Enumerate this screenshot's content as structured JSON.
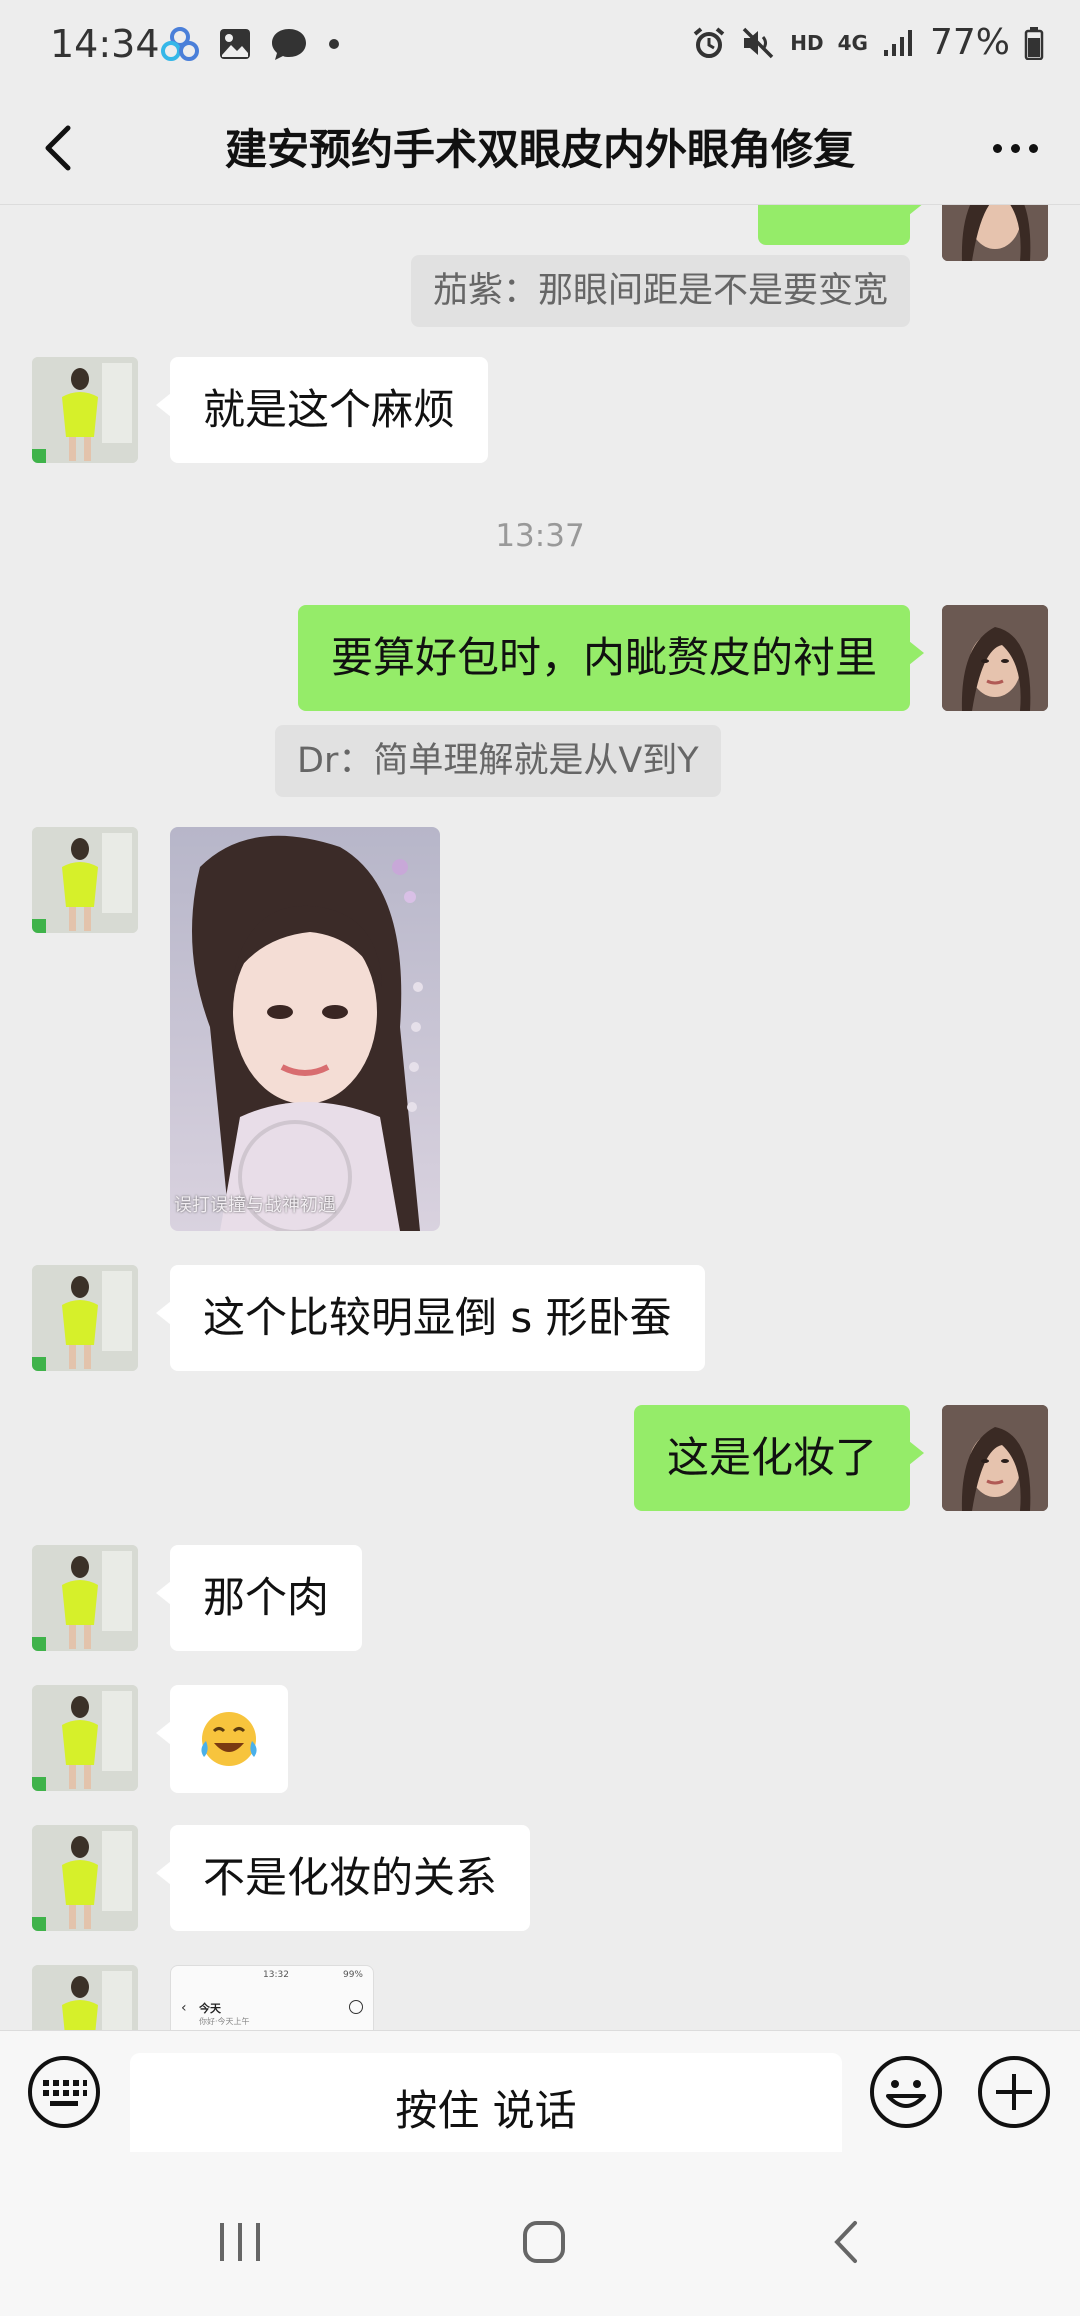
{
  "status_bar": {
    "time": "14:34",
    "left_icons": [
      "baidu-cloud-icon",
      "gallery-icon",
      "message-icon",
      "dot-icon"
    ],
    "right_icons": [
      "alarm-icon",
      "mute-icon",
      "hd-icon",
      "4g-icon",
      "signal-icon",
      "battery-icon"
    ],
    "hd": "HD",
    "network": "4G",
    "battery": "77%"
  },
  "header": {
    "title": "建安预约手术双眼皮内外眼角修复"
  },
  "messages": {
    "quote1": "茄紫：那眼间距是不是要变宽",
    "m1": "就是这个麻烦",
    "time1": "13:37",
    "m2": "要算好包时，内眦赘皮的衬里",
    "quote2": "Dr：简单理解就是从V到Y",
    "image_caption": "误打误撞与战神初遇",
    "m3": "这个比较明显倒 s 形卧蚕",
    "m4": "这是化妆了",
    "m5": "那个肉",
    "m6_emoji": "crying-laughing-emoji",
    "m7": "不是化妆的关系",
    "screenshot_preview": {
      "time": "13:32",
      "battery": "99%",
      "title": "今天",
      "subtitle": "你好·今天上午"
    }
  },
  "input_bar": {
    "voice_label": "按住 说话"
  },
  "colors": {
    "self_bubble": "#95ec69",
    "other_bubble": "#ffffff",
    "background": "#ededed"
  }
}
